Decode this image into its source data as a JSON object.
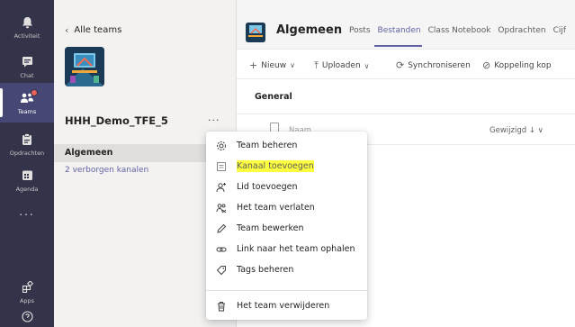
{
  "rail": {
    "items": [
      {
        "label": "Activiteit",
        "icon": "bell-icon"
      },
      {
        "label": "Chat",
        "icon": "chat-icon"
      },
      {
        "label": "Teams",
        "icon": "teams-icon"
      },
      {
        "label": "Opdrachten",
        "icon": "assignments-icon"
      },
      {
        "label": "Agenda",
        "icon": "calendar-icon"
      },
      {
        "label": "Apps",
        "icon": "apps-icon"
      }
    ],
    "more": "..."
  },
  "panel": {
    "back_label": "Alle teams",
    "team_name": "HHH_Demo_TFE_5",
    "more": "...",
    "channel_main": "Algemeen",
    "channel_hidden": "2 verborgen kanalen"
  },
  "main": {
    "title": "Algemeen",
    "tabs": [
      "Posts",
      "Bestanden",
      "Class Notebook",
      "Opdrachten",
      "Cijf"
    ],
    "active_tab": "Bestanden",
    "toolbar": [
      {
        "glyph": "+",
        "label": "Nieuw",
        "arrow": "∨"
      },
      {
        "glyph": "⤒",
        "label": "Uploaden",
        "arrow": "∨"
      },
      {
        "glyph": "⟳",
        "label": "Synchroniseren",
        "arrow": ""
      },
      {
        "glyph": "⊘",
        "label": "Koppeling kop",
        "arrow": ""
      }
    ],
    "section": "General",
    "col_name": "Naam",
    "col_modified": "Gewijzigd ↓ ∨"
  },
  "menu": {
    "items": [
      {
        "label": "Team beheren",
        "icon": "gear-icon"
      },
      {
        "label": "Kanaal toevoegen",
        "icon": "add-channel-icon"
      },
      {
        "label": "Lid toevoegen",
        "icon": "add-person-icon"
      },
      {
        "label": "Het team verlaten",
        "icon": "leave-icon"
      },
      {
        "label": "Team bewerken",
        "icon": "pencil-icon"
      },
      {
        "label": "Link naar het team ophalen",
        "icon": "link-icon"
      },
      {
        "label": "Tags beheren",
        "icon": "tag-icon"
      },
      {
        "label": "Het team verwijderen",
        "icon": "trash-icon"
      }
    ],
    "highlighted_index": 1,
    "highlight_color": "#fdff3f"
  },
  "colors": {
    "rail": "#33344a",
    "accent": "#6264a7",
    "badge": "#e8625c"
  }
}
